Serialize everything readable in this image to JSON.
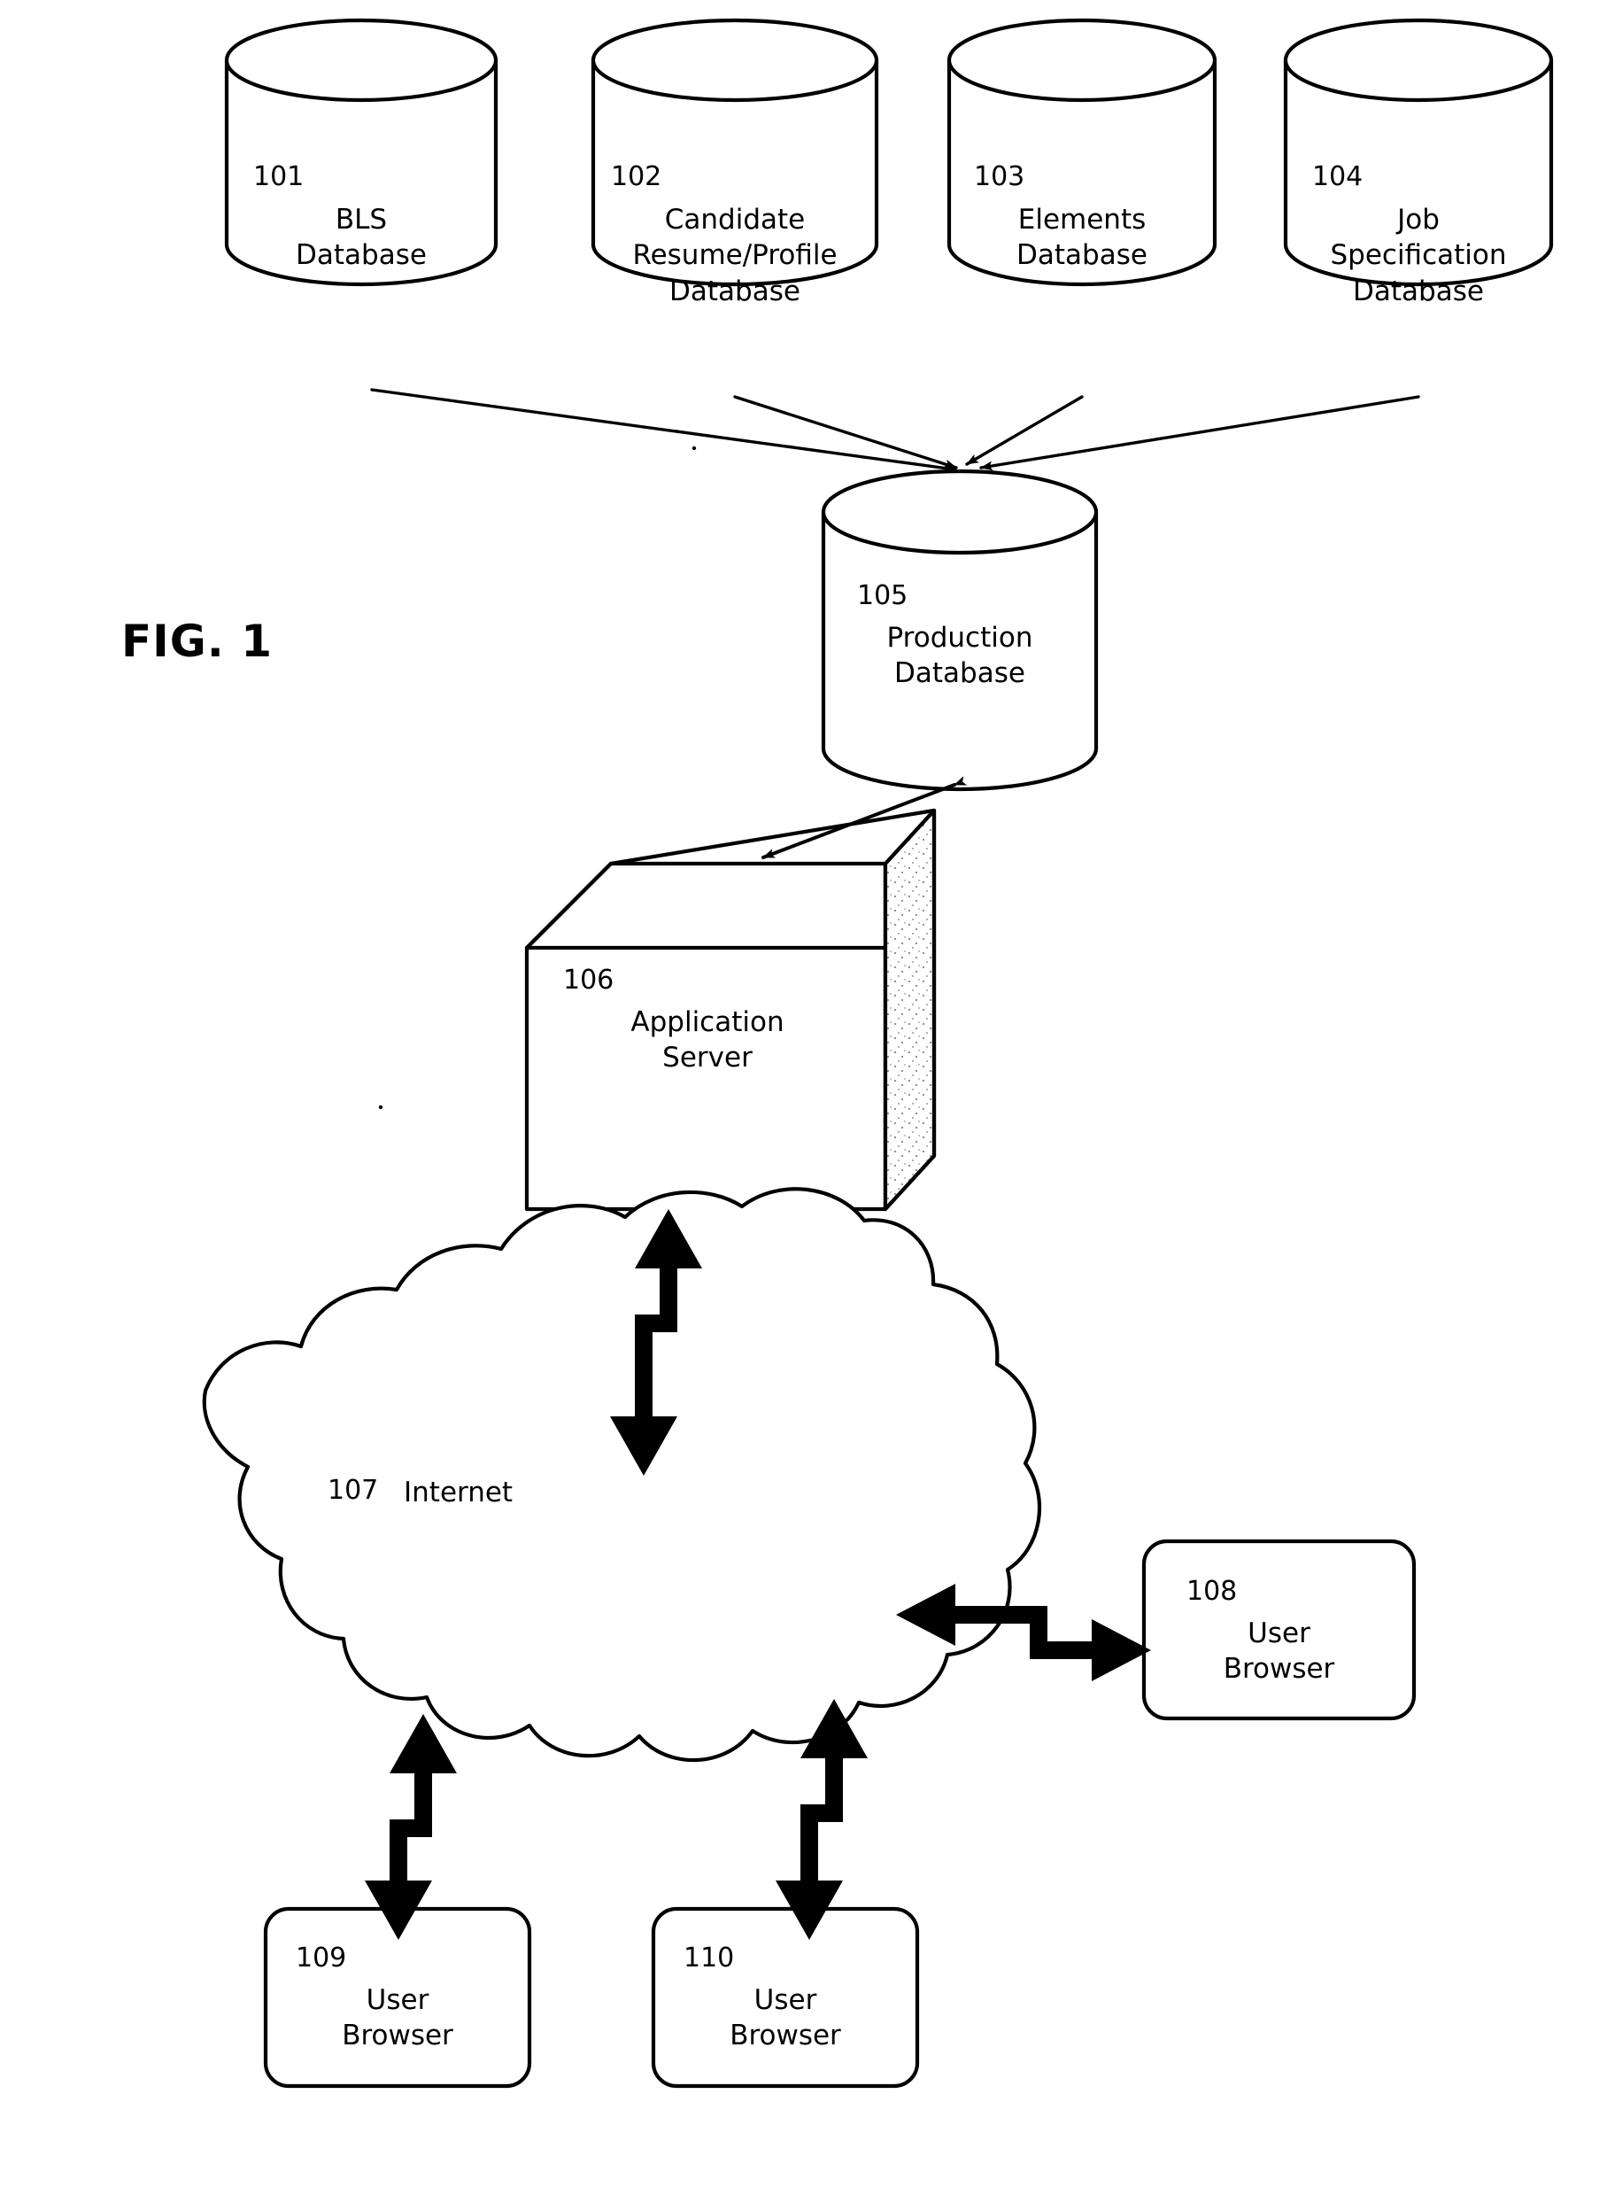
{
  "figure": {
    "title": "FIG. 1",
    "domain_note": "patent system architecture diagram"
  },
  "nodes": {
    "source_databases": [
      {
        "ref": "101",
        "name": "BLS\nDatabase",
        "shape": "cylinder"
      },
      {
        "ref": "102",
        "name": "Candidate\nResume/Profile\nDatabase",
        "shape": "cylinder"
      },
      {
        "ref": "103",
        "name": "Elements\nDatabase",
        "shape": "cylinder"
      },
      {
        "ref": "104",
        "name": "Job\nSpecification\nDatabase",
        "shape": "cylinder"
      }
    ],
    "production_database": {
      "ref": "105",
      "name": "Production\nDatabase",
      "shape": "cylinder"
    },
    "application_server": {
      "ref": "106",
      "name": "Application\nServer",
      "shape": "cube"
    },
    "internet": {
      "ref": "107",
      "name": "Internet",
      "shape": "cloud"
    },
    "user_browsers": [
      {
        "ref": "108",
        "name": "User\nBrowser",
        "shape": "rounded-rect"
      },
      {
        "ref": "109",
        "name": "User\nBrowser",
        "shape": "rounded-rect"
      },
      {
        "ref": "110",
        "name": "User\nBrowser",
        "shape": "rounded-rect"
      }
    ]
  },
  "connections": [
    {
      "from": "101",
      "to": "105",
      "style": "thin-arrow",
      "direction": "one-way"
    },
    {
      "from": "102",
      "to": "105",
      "style": "thin-arrow",
      "direction": "one-way"
    },
    {
      "from": "103",
      "to": "105",
      "style": "thin-arrow",
      "direction": "one-way"
    },
    {
      "from": "104",
      "to": "105",
      "style": "thin-arrow",
      "direction": "one-way"
    },
    {
      "from": "105",
      "to": "106",
      "style": "thin-arrow",
      "direction": "two-way"
    },
    {
      "from": "106",
      "to": "107",
      "style": "thick-arrow",
      "direction": "two-way"
    },
    {
      "from": "107",
      "to": "108",
      "style": "thick-arrow",
      "direction": "two-way"
    },
    {
      "from": "107",
      "to": "109",
      "style": "thick-arrow",
      "direction": "two-way"
    },
    {
      "from": "107",
      "to": "110",
      "style": "thick-arrow",
      "direction": "two-way"
    }
  ],
  "colors": {
    "stroke": "#000000",
    "fill": "#ffffff"
  }
}
